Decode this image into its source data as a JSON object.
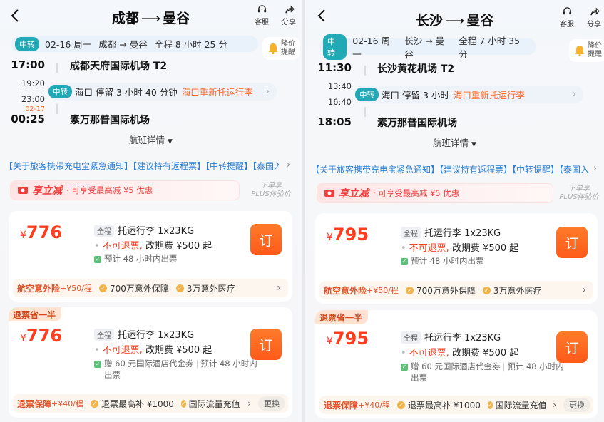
{
  "header_common": {
    "service_label": "客服",
    "share_label": "分享"
  },
  "panels": [
    {
      "title_from": "成都",
      "title_arrow": "⟶",
      "title_to": "曼谷",
      "summary": {
        "transfer_tag": "中转",
        "date": "02-16 周一",
        "route": "成都 → 曼谷",
        "duration": "全程 8 小时 25 分"
      },
      "bell": {
        "line1": "降价",
        "line2": "提醒"
      },
      "timeline": {
        "dep_time": "17:00",
        "dep_airport": "成都天府国际机场 T2",
        "stop_arr": "19:20",
        "stop_dep": "23:00",
        "stop_tag": "中转",
        "stop_city": "海口",
        "stop_stay": "停留 3 小时 40 分钟",
        "stop_warn": "海口重新托运行李",
        "arr_date_flag": "02-17",
        "arr_time": "00:25",
        "arr_airport": "素万那普国际机场"
      },
      "details_label": "航班详情",
      "notice": "【关于旅客携带充电宝紧急通知】【建议持有返程票】【中转提醒】【泰国入...",
      "promo": {
        "title": "享立减",
        "desc": "· 可享受最高减 ¥5 优惠",
        "plus_line1": "下单享",
        "plus_line2": "PLUS体验价"
      },
      "cards": [
        {
          "badge": "",
          "currency": "¥",
          "price": "776",
          "fare_tag": "全程",
          "baggage": "托运行李 1x23KG",
          "refund_warn": "不可退票,",
          "change_fee": "改期费 ¥500 起",
          "extra1": "预计 48 小时内出票",
          "extra2": "",
          "book_label": "订",
          "ins_name": "航空意外险",
          "ins_price": "+¥50/程",
          "feat1": "700万意外保障",
          "feat2": "3万意外医疗",
          "swap_label": ""
        },
        {
          "badge": "退票省一半",
          "currency": "¥",
          "price": "776",
          "fare_tag": "全程",
          "baggage": "托运行李 1x23KG",
          "refund_warn": "不可退票,",
          "change_fee": "改期费 ¥500 起",
          "extra1": "赠 60 元国际酒店代金券",
          "extra2": "预计 48 小时内",
          "extra3": "出票",
          "book_label": "订",
          "ins_name": "退票保障",
          "ins_price": "+¥40/程",
          "feat1": "退票最高补 ¥1000",
          "feat2": "国际流量充值",
          "swap_label": "更换"
        }
      ]
    },
    {
      "title_from": "长沙",
      "title_arrow": "⟶",
      "title_to": "曼谷",
      "summary": {
        "transfer_tag": "中转",
        "date": "02-16 周一",
        "route": "长沙 → 曼谷",
        "duration": "全程 7 小时 35 分"
      },
      "bell": {
        "line1": "降价",
        "line2": "提醒"
      },
      "timeline": {
        "dep_time": "11:30",
        "dep_airport": "长沙黄花机场 T2",
        "stop_arr": "13:40",
        "stop_dep": "16:40",
        "stop_tag": "中转",
        "stop_city": "海口",
        "stop_stay": "停留 3 小时",
        "stop_warn": "海口重新托运行李",
        "arr_date_flag": "",
        "arr_time": "18:05",
        "arr_airport": "素万那普国际机场"
      },
      "details_label": "航班详情",
      "notice": "【关于旅客携带充电宝紧急通知】【建议持有返程票】【中转提醒】【泰国入...",
      "promo": {
        "title": "享立减",
        "desc": "· 可享受最高减 ¥5 优惠",
        "plus_line1": "下单享",
        "plus_line2": "PLUS体验价"
      },
      "cards": [
        {
          "badge": "",
          "currency": "¥",
          "price": "795",
          "fare_tag": "全程",
          "baggage": "托运行李 1x23KG",
          "refund_warn": "不可退票,",
          "change_fee": "改期费 ¥500 起",
          "extra1": "预计 48 小时内出票",
          "extra2": "",
          "book_label": "订",
          "ins_name": "航空意外险",
          "ins_price": "+¥50/程",
          "feat1": "700万意外保障",
          "feat2": "3万意外医疗",
          "swap_label": ""
        },
        {
          "badge": "退票省一半",
          "currency": "¥",
          "price": "795",
          "fare_tag": "全程",
          "baggage": "托运行李 1x23KG",
          "refund_warn": "不可退票,",
          "change_fee": "改期费 ¥500 起",
          "extra1": "赠 60 元国际酒店代金券",
          "extra2": "预计 48 小时内",
          "extra3": "出票",
          "book_label": "订",
          "ins_name": "退票保障",
          "ins_price": "+¥40/程",
          "feat1": "退票最高补 ¥1000",
          "feat2": "国际流量充值",
          "swap_label": "更换"
        }
      ]
    }
  ]
}
